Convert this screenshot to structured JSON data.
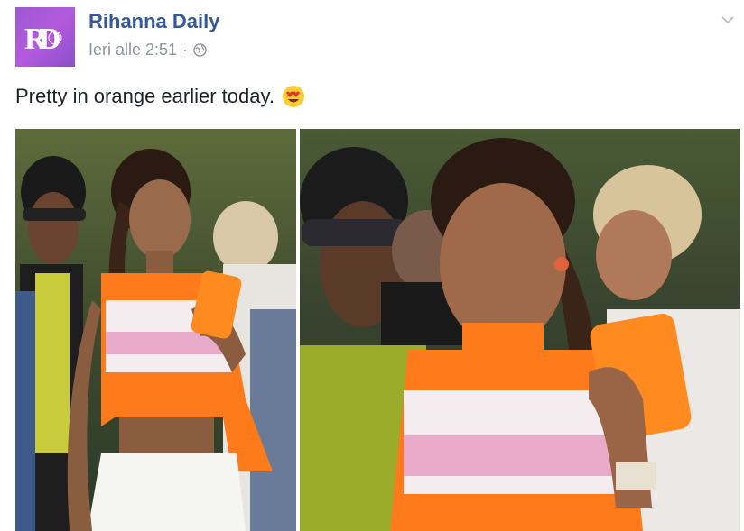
{
  "post": {
    "page_name": "Rihanna Daily",
    "timestamp": "Ieri alle 2:51",
    "separator": "·",
    "caption": "Pretty in orange earlier today.",
    "avatar_text": "RD"
  },
  "icons": {
    "avatar": "rihanna-daily-logo",
    "privacy": "globe-icon",
    "menu": "chevron-down-icon",
    "emoji": "heart-eyes-emoji"
  },
  "colors": {
    "link": "#365899",
    "meta": "#90949c",
    "avatar_bg": "#a855d8",
    "top_orange": "#ff7a1a"
  }
}
